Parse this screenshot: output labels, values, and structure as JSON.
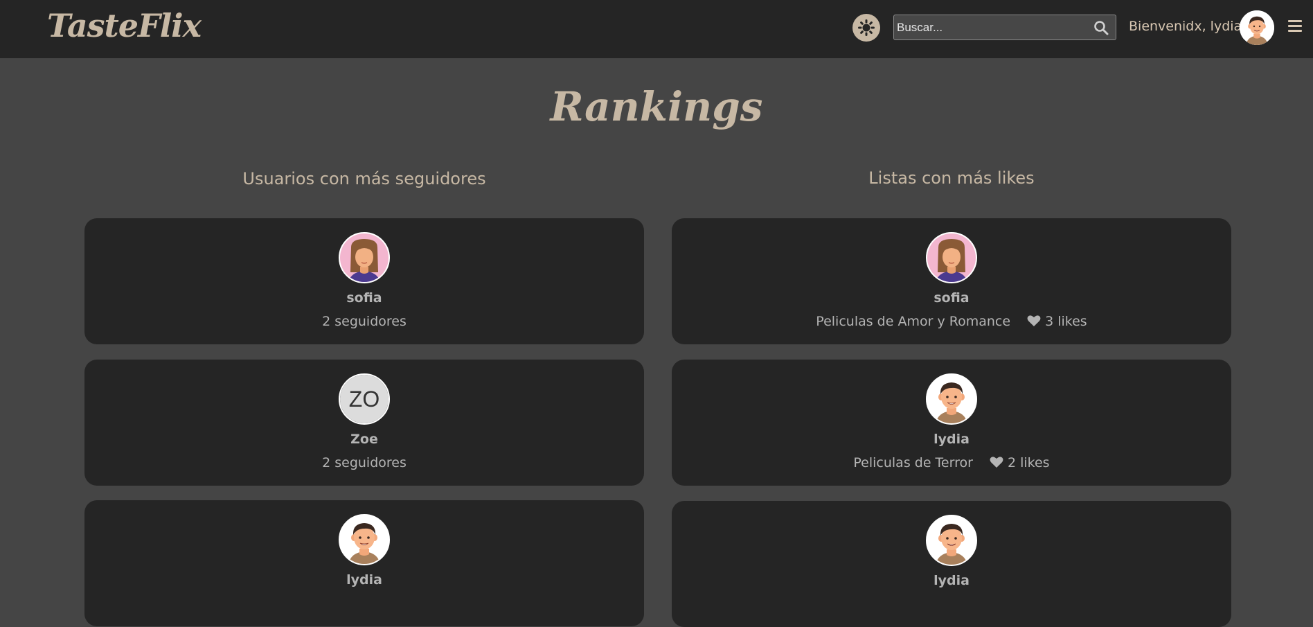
{
  "navbar": {
    "logo": "TasteFlix",
    "theme_toggle_icon": "sun-icon",
    "search": {
      "placeholder": "Buscar...",
      "value": ""
    },
    "welcome_text": "Bienvenidx, lydia",
    "colors": {
      "accent": "#c7b8a4",
      "background": "#252525"
    }
  },
  "page": {
    "title": "Rankings",
    "background": "#454545"
  },
  "followers_column": {
    "title": "Usuarios con más seguidores",
    "items": [
      {
        "name": "sofia",
        "subtitle": "2 seguidores",
        "avatar": "female-avatar"
      },
      {
        "name": "Zoe",
        "subtitle": "2 seguidores",
        "avatar": "initials",
        "initials": "ZO"
      },
      {
        "name": "lydia",
        "subtitle": "",
        "avatar": "male-avatar"
      }
    ]
  },
  "likes_column": {
    "title": "Listas con más likes",
    "items": [
      {
        "name": "sofia",
        "list": "Peliculas de Amor y Romance",
        "likes": "3 likes",
        "avatar": "female-avatar"
      },
      {
        "name": "lydia",
        "list": "Peliculas de Terror",
        "likes": "2 likes",
        "avatar": "male-avatar"
      },
      {
        "name": "lydia",
        "list": "",
        "likes": "",
        "avatar": "male-avatar"
      }
    ]
  }
}
